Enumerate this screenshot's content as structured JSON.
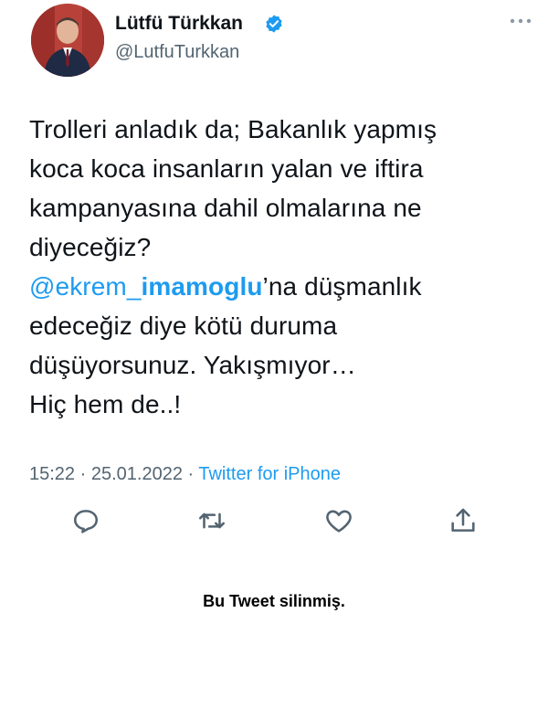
{
  "author": {
    "display_name": "Lütfü Türkkan",
    "handle": "@LutfuTurkkan",
    "verified": true,
    "avatar_icon": "profile-photo",
    "verified_icon": "verified-badge-icon"
  },
  "more_icon": "ellipsis-icon",
  "tweet": {
    "lines": [
      "Trolleri anladık da; Bakanlık yapmış",
      "koca koca insanların yalan ve iftira",
      "kampanyasına dahil olmalarına ne",
      "diyeceğiz?"
    ],
    "mention_prefix": "@ekrem_",
    "mention_bold": "imamoglu",
    "mention_suffix": "’na düşmanlık",
    "lines_after": [
      "edeceğiz diye kötü duruma",
      "düşüyorsunuz. Yakışmıyor…",
      "Hiç hem de..!"
    ]
  },
  "meta": {
    "time": "15:22",
    "separator": " · ",
    "date": "25.01.2022",
    "source": "Twitter for iPhone"
  },
  "actions": {
    "reply_icon": "reply-icon",
    "retweet_icon": "retweet-icon",
    "like_icon": "heart-icon",
    "share_icon": "share-icon"
  },
  "caption": "Bu Tweet silinmiş.",
  "colors": {
    "accent": "#1d9bf0",
    "secondary_text": "#536471",
    "primary_text": "#0f1419"
  }
}
